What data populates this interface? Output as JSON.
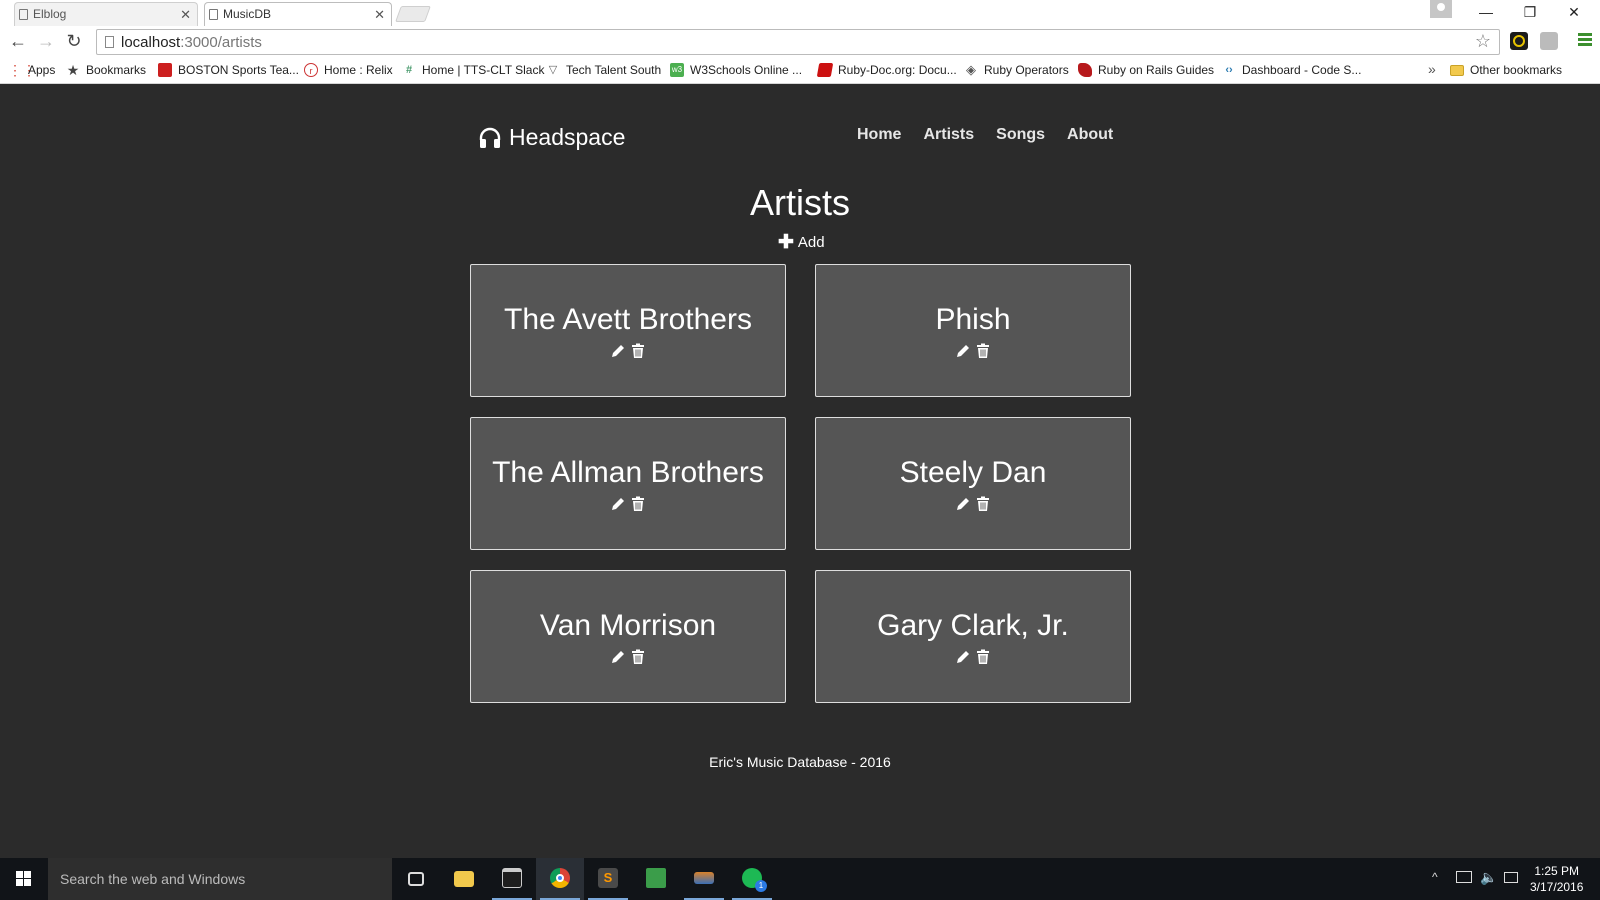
{
  "browser": {
    "tabs": [
      {
        "title": "Elblog",
        "active": false
      },
      {
        "title": "MusicDB",
        "active": true
      }
    ],
    "window_controls": {
      "minimize": "—",
      "restore": "❐",
      "close": "✕"
    },
    "address": {
      "host": "localhost",
      "path": ":3000/artists"
    },
    "bookmarks": [
      {
        "label": "Apps",
        "icon": "apps-grid-icon",
        "color": "#d64a3b"
      },
      {
        "label": "Bookmarks",
        "icon": "star-icon",
        "color": "#444444"
      },
      {
        "label": "BOSTON Sports Tea...",
        "icon": "boston-sports-icon",
        "color": "#cc1f1f"
      },
      {
        "label": "Home : Relix",
        "icon": "relix-icon",
        "color": "#cc3333"
      },
      {
        "label": "Home | TTS-CLT Slack",
        "icon": "slack-icon",
        "color": "#4a9b6e"
      },
      {
        "label": "Tech Talent South",
        "icon": "tts-icon",
        "color": "#666666"
      },
      {
        "label": "W3Schools Online ...",
        "icon": "w3schools-icon",
        "color": "#4caf50"
      },
      {
        "label": "Ruby-Doc.org: Docu...",
        "icon": "ruby-doc-icon",
        "color": "#cc1111"
      },
      {
        "label": "Ruby Operators",
        "icon": "ruby-operators-icon",
        "color": "#555555"
      },
      {
        "label": "Ruby on Rails Guides",
        "icon": "rails-guides-icon",
        "color": "#b7191c"
      },
      {
        "label": "Dashboard - Code S...",
        "icon": "code-school-icon",
        "color": "#2a7ab0"
      }
    ],
    "bookmarks_overflow": "»",
    "other_bookmarks": "Other bookmarks"
  },
  "site": {
    "brand": "Headspace",
    "nav": [
      "Home",
      "Artists",
      "Songs",
      "About"
    ],
    "page_title": "Artists",
    "add_label": "Add",
    "artists": [
      {
        "name": "The Avett Brothers"
      },
      {
        "name": "Phish"
      },
      {
        "name": "The Allman Brothers"
      },
      {
        "name": "Steely Dan"
      },
      {
        "name": "Van Morrison"
      },
      {
        "name": "Gary Clark, Jr."
      }
    ],
    "footer": "Eric's Music Database - 2016",
    "colors": {
      "background": "#2b2b2b",
      "card": "#555555",
      "card_border": "#dedede",
      "text": "#ffffff"
    }
  },
  "taskbar": {
    "search_placeholder": "Search the web and Windows",
    "apps": [
      "task-view-icon",
      "file-explorer-icon",
      "terminal-icon",
      "chrome-icon",
      "sublime-text-icon",
      "hp-store-icon",
      "app-icon",
      "spotify-icon"
    ],
    "spotify_badge": "1",
    "time": "1:25 PM",
    "date": "3/17/2016"
  }
}
